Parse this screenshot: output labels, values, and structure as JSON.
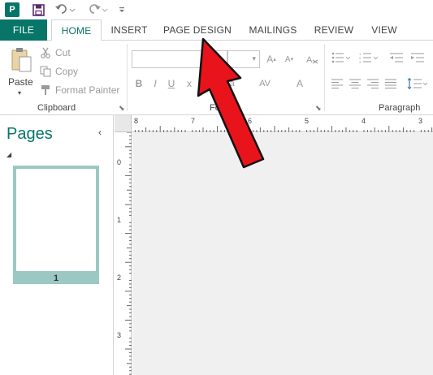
{
  "app": {
    "name": "Publisher",
    "logo_letter": "P"
  },
  "tabs": {
    "file": "FILE",
    "home": "HOME",
    "insert": "INSERT",
    "page_design": "PAGE DESIGN",
    "mailings": "MAILINGS",
    "review": "REVIEW",
    "view": "VIEW"
  },
  "clipboard": {
    "paste": "Paste",
    "cut": "Cut",
    "copy": "Copy",
    "format_painter": "Format Painter",
    "group_label": "Clipboard"
  },
  "font": {
    "group_label": "Font",
    "bold": "B",
    "italic": "I",
    "underline": "U",
    "subscript": "x",
    "font_color": "A",
    "grow": "A",
    "shrink": "A",
    "char_spacing": "AV",
    "change_case": "Aa"
  },
  "paragraph": {
    "group_label": "Paragraph"
  },
  "pages_pane": {
    "title": "Pages",
    "page_number": "1"
  },
  "ruler": {
    "horizontal_labels": [
      "8",
      "7",
      "6",
      "5",
      "4",
      "3"
    ],
    "vertical_labels": [
      "0",
      "1",
      "2",
      "3"
    ]
  },
  "colors": {
    "accent": "#077568",
    "arrow": "#e8131b",
    "thumb_frame": "#9bc8c3",
    "canvas": "#f0f0f0"
  },
  "icons": {
    "save": "save-icon",
    "undo": "undo-icon",
    "redo": "redo-icon",
    "customize": "customize-qat-icon"
  }
}
